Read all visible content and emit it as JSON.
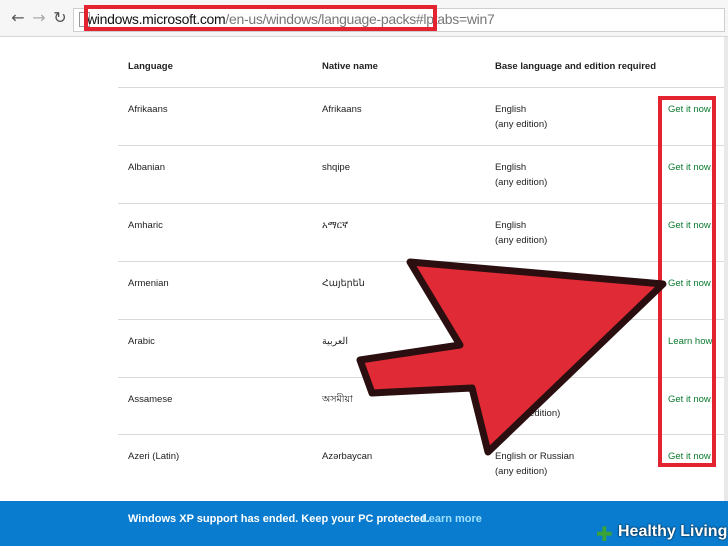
{
  "browser": {
    "url_host": "windows.microsoft.com",
    "url_path": "/en-us/windows/language-packs#lptabs=win7"
  },
  "table": {
    "headers": {
      "language": "Language",
      "native": "Native name",
      "base": "Base language and edition required"
    },
    "rows": [
      {
        "language": "Afrikaans",
        "native": "Afrikaans",
        "base_lang": "English",
        "edition": "(any edition)",
        "action": "Get it now"
      },
      {
        "language": "Albanian",
        "native": "shqipe",
        "base_lang": "English",
        "edition": "(any edition)",
        "action": "Get it now"
      },
      {
        "language": "Amharic",
        "native": "አማርኛ",
        "base_lang": "English",
        "edition": "(any edition)",
        "action": "Get it now"
      },
      {
        "language": "Armenian",
        "native": "Հայերեն",
        "base_lang": "",
        "edition": "",
        "action": "Get it now"
      },
      {
        "language": "Arabic",
        "native": "العربية",
        "base_lang": "",
        "edition": "",
        "action": "Learn how"
      },
      {
        "language": "Assamese",
        "native": "অসমীয়া",
        "base_lang": "",
        "edition": "(any edition)",
        "action": "Get it now"
      },
      {
        "language": "Azeri (Latin)",
        "native": "Azərbaycan",
        "base_lang": "English or Russian",
        "edition": "(any edition)",
        "action": "Get it now"
      }
    ]
  },
  "banner": {
    "text": "Windows XP support has ended. Keep your PC protected.",
    "link": "Learn more"
  },
  "watermark": {
    "text": "Healthy Living"
  },
  "colors": {
    "highlight": "#e32430",
    "link_green": "#0b7a2f",
    "banner_blue": "#0a7ccf"
  }
}
